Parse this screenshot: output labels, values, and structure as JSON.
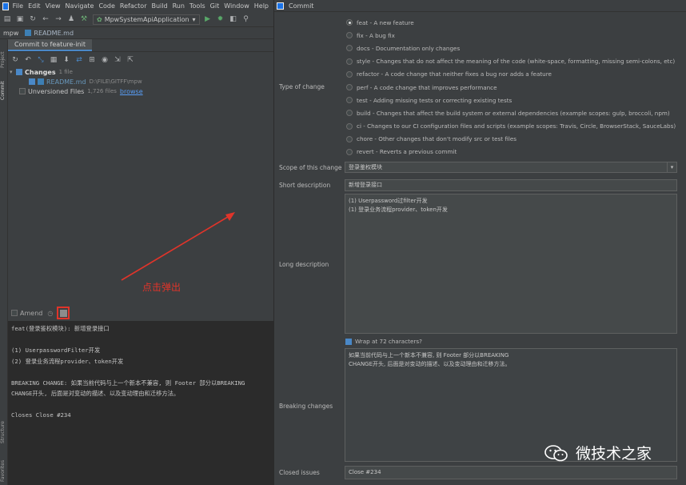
{
  "ide": {
    "menus": [
      "File",
      "Edit",
      "View",
      "Navigate",
      "Code",
      "Refactor",
      "Build",
      "Run",
      "Tools",
      "Git",
      "Window",
      "Help"
    ],
    "run_config": "MpwSystemApiApplication",
    "breadcrumb": {
      "project": "mpw",
      "file": "README.md"
    },
    "side_tabs": [
      "Project",
      "Commit",
      "Structure",
      "Favorites"
    ],
    "commit_tab": "Commit to feature-init",
    "changes": {
      "label": "Changes",
      "count": "1 file",
      "file_name": "README.md",
      "file_path": "D:\\FILE\\GITFF\\mpw",
      "unversioned_label": "Unversioned Files",
      "unversioned_count": "1,726 files",
      "browse": "browse"
    },
    "amend_label": "Amend",
    "commit_message": "feat(登录鉴权模块): 新增登录接口\n\n(1) UserpasswordFilter开发\n(2) 登录业务流程provider、token开发\n\nBREAKING CHANGE: 如果当前代码与上一个新本不兼容, 则 Footer 部分以BREAKING\nCHANGE开头, 后面是对变动的描述、以及变动理由和迁移方法。\n\nCloses Close #234"
  },
  "annotation": {
    "text": "点击弹出",
    "color": "#e0342a"
  },
  "dialog": {
    "title": "Commit",
    "labels": {
      "type_of_change": "Type of change",
      "scope": "Scope of this change",
      "short_description": "Short description",
      "long_description": "Long description",
      "breaking_changes": "Breaking changes",
      "closed_issues": "Closed issues"
    },
    "change_types": [
      {
        "label": "feat - A new feature",
        "selected": true
      },
      {
        "label": "fix - A bug fix",
        "selected": false
      },
      {
        "label": "docs - Documentation only changes",
        "selected": false
      },
      {
        "label": "style - Changes that do not affect the meaning of the code (white-space, formatting, missing semi-colons, etc)",
        "selected": false
      },
      {
        "label": "refactor - A code change that neither fixes a bug nor adds a feature",
        "selected": false
      },
      {
        "label": "perf - A code change that improves performance",
        "selected": false
      },
      {
        "label": "test - Adding missing tests or correcting existing tests",
        "selected": false
      },
      {
        "label": "build - Changes that affect the build system or external dependencies (example scopes: gulp, broccoli, npm)",
        "selected": false
      },
      {
        "label": "ci - Changes to our CI configuration files and scripts (example scopes: Travis, Circle, BrowserStack, SauceLabs)",
        "selected": false
      },
      {
        "label": "chore - Other changes that don't modify src or test files",
        "selected": false
      },
      {
        "label": "revert - Reverts a previous commit",
        "selected": false
      }
    ],
    "scope_value": "登录鉴权模块",
    "short_description_value": "新增登录接口",
    "long_description_value": "(1) Userpassword过filter开发\n(1) 登录业务流程provider、token开发",
    "wrap_label": "Wrap at 72 characters?",
    "breaking_changes_value": "如果当前代码与上一个新本不兼容, 则 Footer 部分以BREAKING\nCHANGE开头, 后面是对变动的描述、以及变动理由和迁移方法。",
    "closed_issues_value": "Close #234"
  },
  "watermark": {
    "text": "微技术之家"
  }
}
